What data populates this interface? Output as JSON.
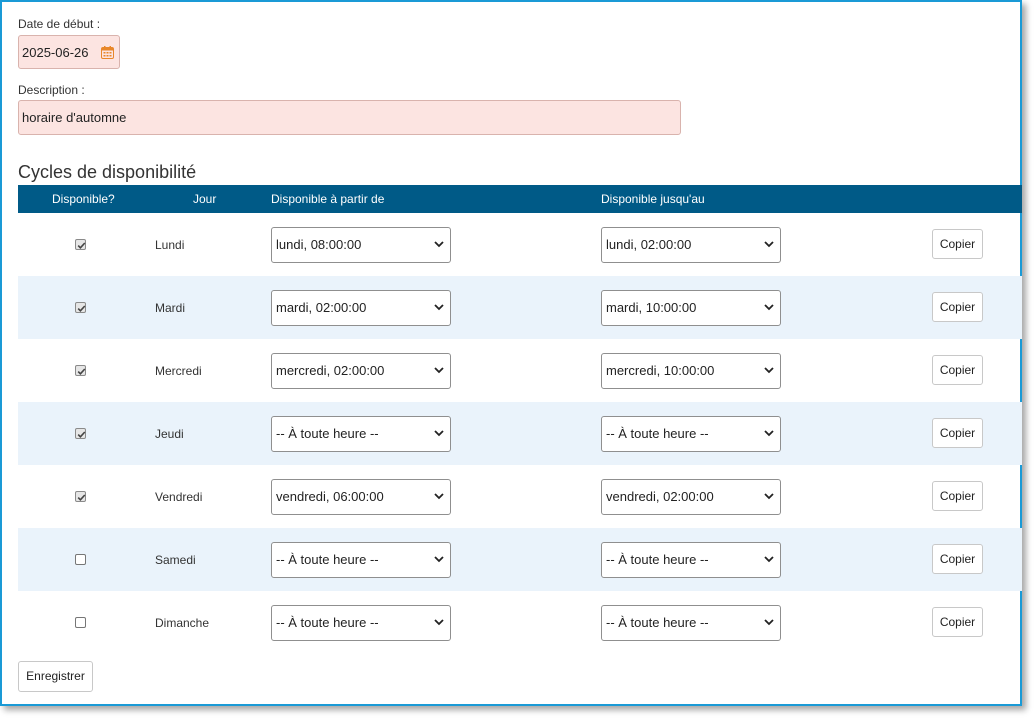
{
  "form": {
    "start_date_label": "Date de début :",
    "start_date_value": "2025-06-26",
    "description_label": "Description :",
    "description_value": "horaire d'automne"
  },
  "cycles": {
    "title": "Cycles de disponibilité",
    "headers": {
      "available": "Disponible?",
      "day": "Jour",
      "from": "Disponible à partir de",
      "until": "Disponible jusqu'au"
    },
    "rows": [
      {
        "day": "Lundi",
        "checked": true,
        "from": "lundi, 08:00:00",
        "until": "lundi, 02:00:00",
        "copy": "Copier"
      },
      {
        "day": "Mardi",
        "checked": true,
        "from": "mardi, 02:00:00",
        "until": "mardi, 10:00:00",
        "copy": "Copier"
      },
      {
        "day": "Mercredi",
        "checked": true,
        "from": "mercredi, 02:00:00",
        "until": "mercredi, 10:00:00",
        "copy": "Copier"
      },
      {
        "day": "Jeudi",
        "checked": true,
        "from": "-- À toute heure --",
        "until": "-- À toute heure --",
        "copy": "Copier"
      },
      {
        "day": "Vendredi",
        "checked": true,
        "from": "vendredi, 06:00:00",
        "until": "vendredi, 02:00:00",
        "copy": "Copier"
      },
      {
        "day": "Samedi",
        "checked": false,
        "from": "-- À toute heure --",
        "until": "-- À toute heure --",
        "copy": "Copier"
      },
      {
        "day": "Dimanche",
        "checked": false,
        "from": "-- À toute heure --",
        "until": "-- À toute heure --",
        "copy": "Copier"
      }
    ]
  },
  "actions": {
    "save_label": "Enregistrer"
  },
  "colors": {
    "header_bg": "#005a87",
    "alt_row_bg": "#eaf3fb",
    "invalid_field_bg": "#fce4e1",
    "frame_border": "#1a9ad6"
  },
  "icons": {
    "date_picker": "calendar-icon",
    "select_arrow": "chevron-down-icon",
    "check": "checkmark-icon"
  }
}
